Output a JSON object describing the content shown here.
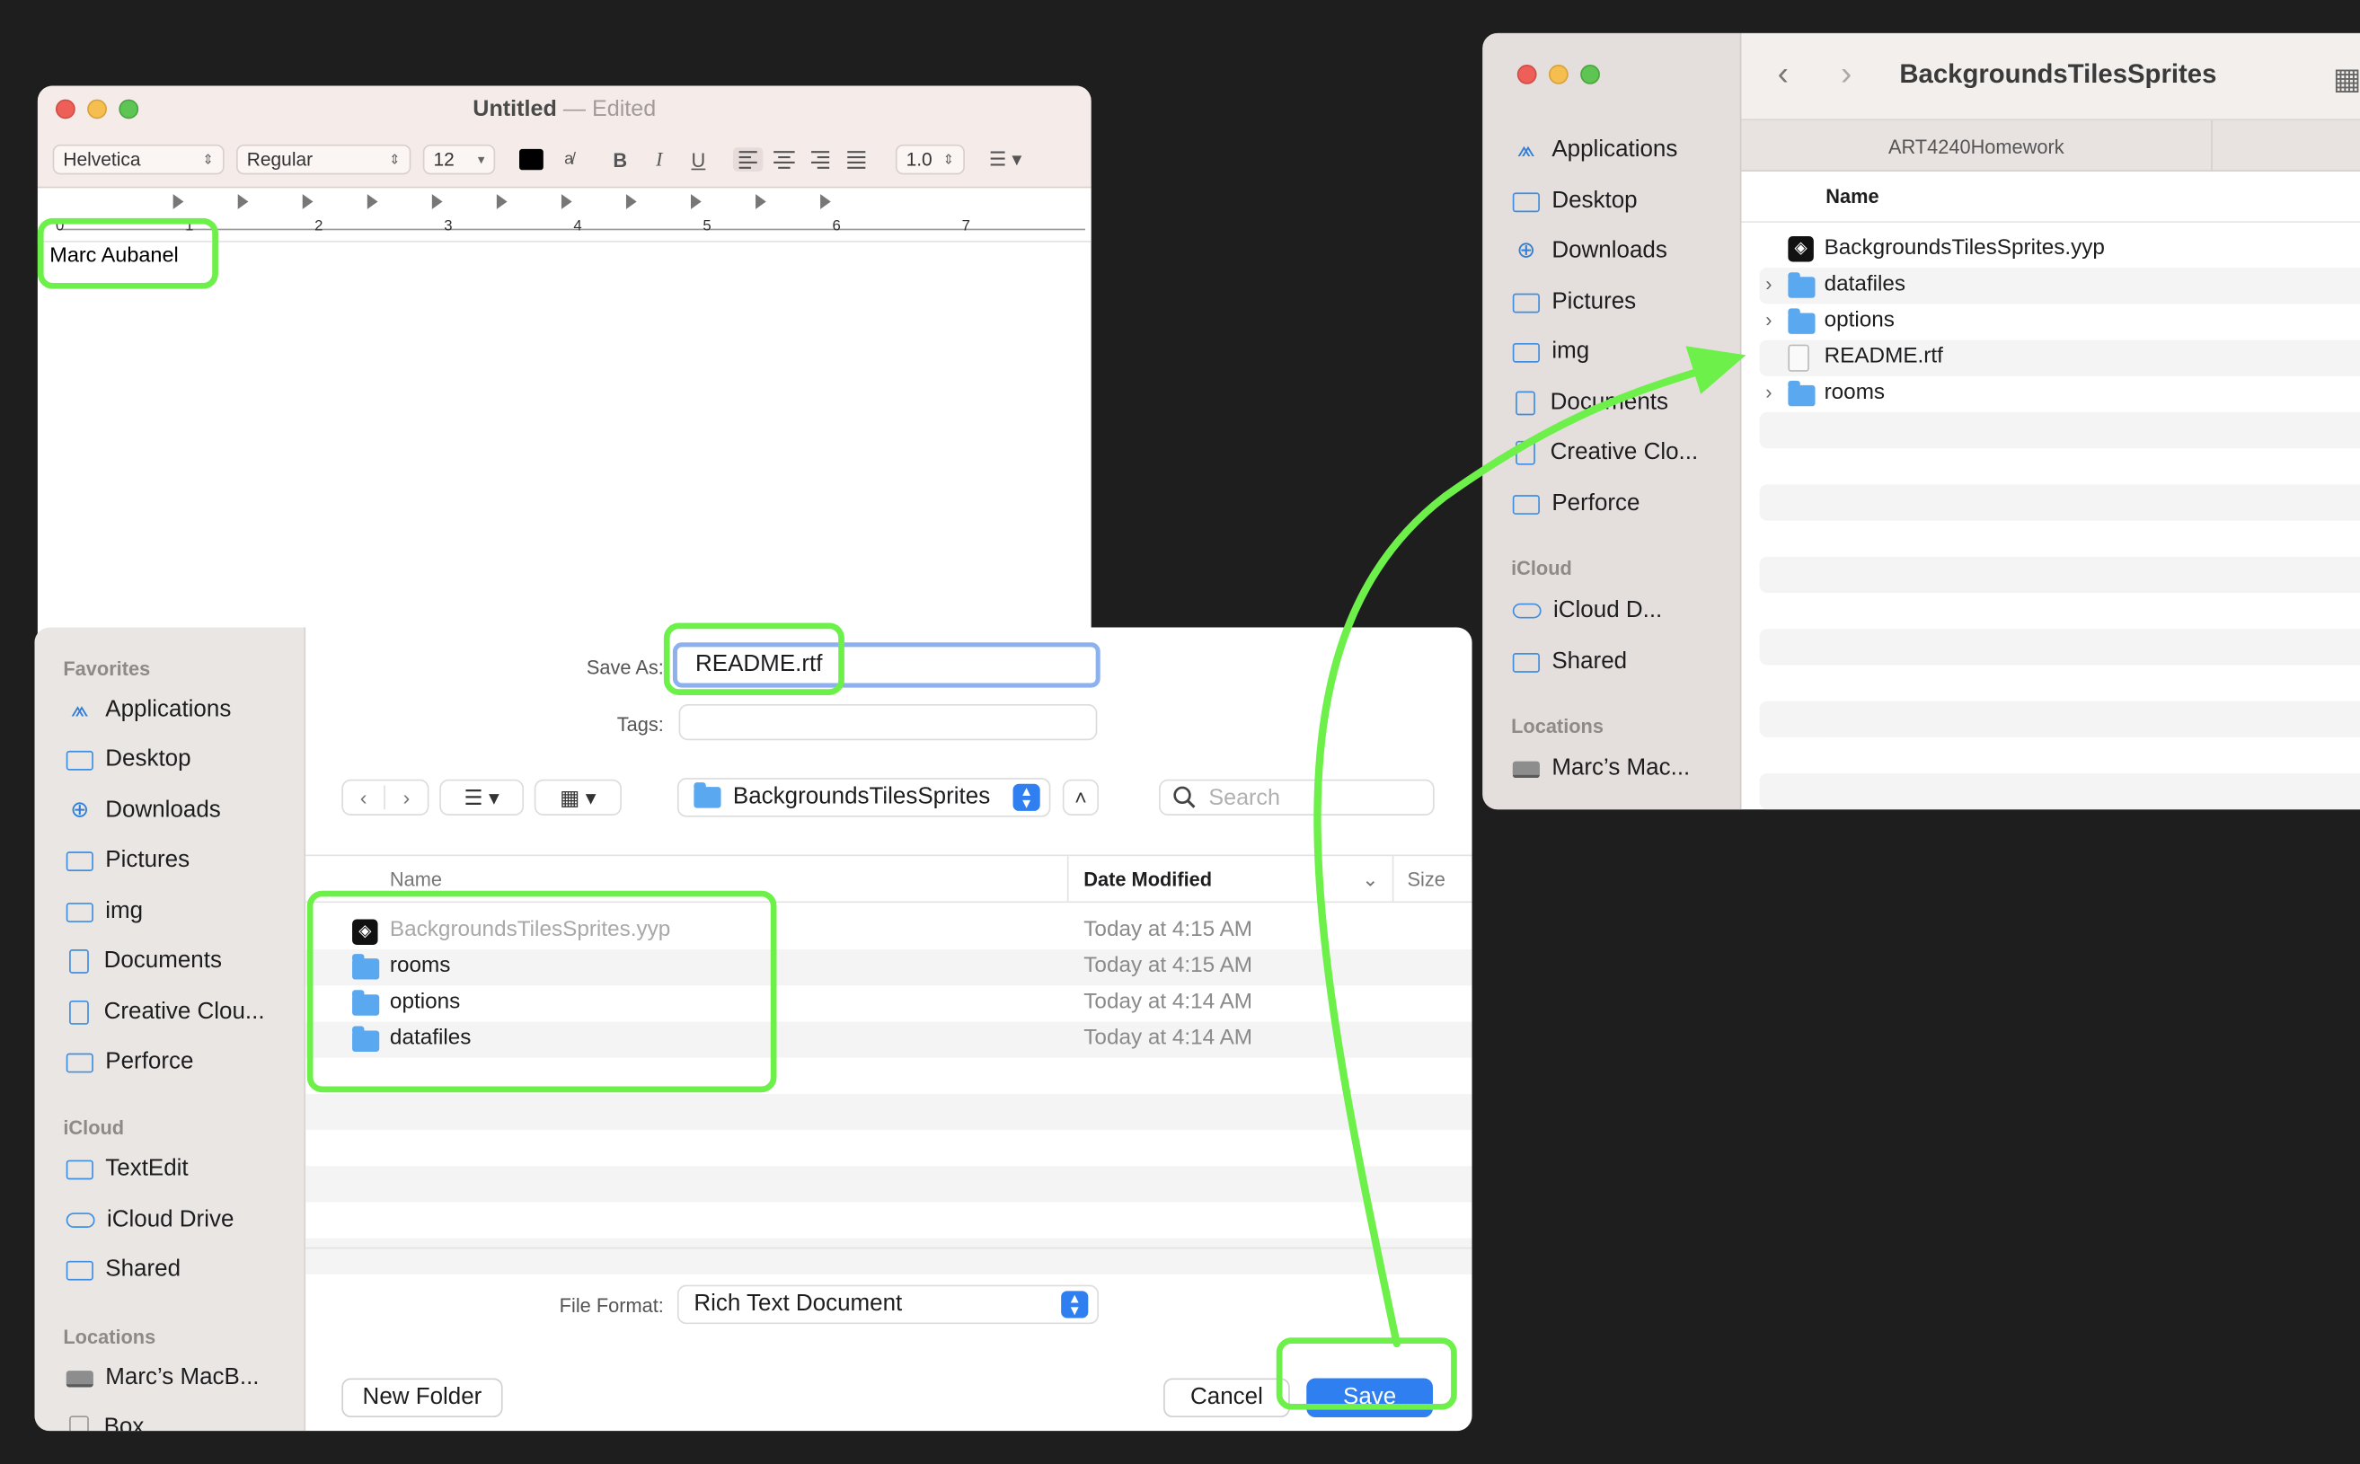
{
  "textedit": {
    "title": "Untitled",
    "title_sep": "—",
    "status": "Edited",
    "font_family": "Helvetica",
    "font_style": "Regular",
    "font_size": "12",
    "line_spacing": "1.0",
    "bold": "B",
    "italic": "I",
    "underline": "U",
    "ruler_numbers": [
      "0",
      "1",
      "2",
      "3",
      "4",
      "5",
      "6",
      "7"
    ],
    "body_text": "Marc Aubanel"
  },
  "save_dialog": {
    "sidebar": {
      "favorites_header": "Favorites",
      "favorites": [
        {
          "label": "Applications",
          "icon": "applications-icon"
        },
        {
          "label": "Desktop",
          "icon": "desktop-icon"
        },
        {
          "label": "Downloads",
          "icon": "downloads-icon"
        },
        {
          "label": "Pictures",
          "icon": "pictures-icon"
        },
        {
          "label": "img",
          "icon": "folder-icon"
        },
        {
          "label": "Documents",
          "icon": "document-icon"
        },
        {
          "label": "Creative Clou...",
          "icon": "document-icon"
        },
        {
          "label": "Perforce",
          "icon": "folder-icon"
        }
      ],
      "icloud_header": "iCloud",
      "icloud": [
        {
          "label": "TextEdit",
          "icon": "folder-icon"
        },
        {
          "label": "iCloud Drive",
          "icon": "cloud-icon"
        },
        {
          "label": "Shared",
          "icon": "shared-folder-icon"
        }
      ],
      "locations_header": "Locations",
      "locations": [
        {
          "label": "Marc’s MacB...",
          "icon": "laptop-icon"
        },
        {
          "label": "Box",
          "icon": "box-icon"
        }
      ]
    },
    "save_as_label": "Save As:",
    "save_as_value": "README.rtf",
    "tags_label": "Tags:",
    "tags_value": "",
    "location": "BackgroundsTilesSprites",
    "search_placeholder": "Search",
    "columns": {
      "name": "Name",
      "date": "Date Modified",
      "size": "Size"
    },
    "files": [
      {
        "name": "BackgroundsTilesSprites.yyp",
        "date": "Today at 4:15 AM",
        "type": "yyp",
        "dimmed": true
      },
      {
        "name": "rooms",
        "date": "Today at 4:15 AM",
        "type": "folder"
      },
      {
        "name": "options",
        "date": "Today at 4:14 AM",
        "type": "folder"
      },
      {
        "name": "datafiles",
        "date": "Today at 4:14 AM",
        "type": "folder"
      }
    ],
    "file_format_label": "File Format:",
    "file_format_value": "Rich Text Document",
    "new_folder_label": "New Folder",
    "cancel_label": "Cancel",
    "save_label": "Save"
  },
  "finder": {
    "title": "BackgroundsTilesSprites",
    "tab": "ART4240Homework",
    "column_name": "Name",
    "sidebar": {
      "items": [
        {
          "label": "Applications",
          "icon": "applications-icon"
        },
        {
          "label": "Desktop",
          "icon": "desktop-icon"
        },
        {
          "label": "Downloads",
          "icon": "downloads-icon"
        },
        {
          "label": "Pictures",
          "icon": "pictures-icon"
        },
        {
          "label": "img",
          "icon": "folder-icon"
        },
        {
          "label": "Documents",
          "icon": "document-icon"
        },
        {
          "label": "Creative Clo...",
          "icon": "document-icon"
        },
        {
          "label": "Perforce",
          "icon": "folder-icon"
        }
      ],
      "icloud_header": "iCloud",
      "icloud": [
        {
          "label": "iCloud D...",
          "icon": "cloud-icon"
        },
        {
          "label": "Shared",
          "icon": "shared-folder-icon"
        }
      ],
      "locations_header": "Locations",
      "locations": [
        {
          "label": "Marc’s Mac...",
          "icon": "laptop-icon"
        }
      ]
    },
    "files": [
      {
        "name": "BackgroundsTilesSprites.yyp",
        "type": "yyp",
        "expandable": false
      },
      {
        "name": "datafiles",
        "type": "folder",
        "expandable": true
      },
      {
        "name": "options",
        "type": "folder",
        "expandable": true
      },
      {
        "name": "README.rtf",
        "type": "rtf",
        "expandable": false
      },
      {
        "name": "rooms",
        "type": "folder",
        "expandable": true
      }
    ]
  },
  "annotations": {
    "highlight_color": "#6ef04a"
  }
}
